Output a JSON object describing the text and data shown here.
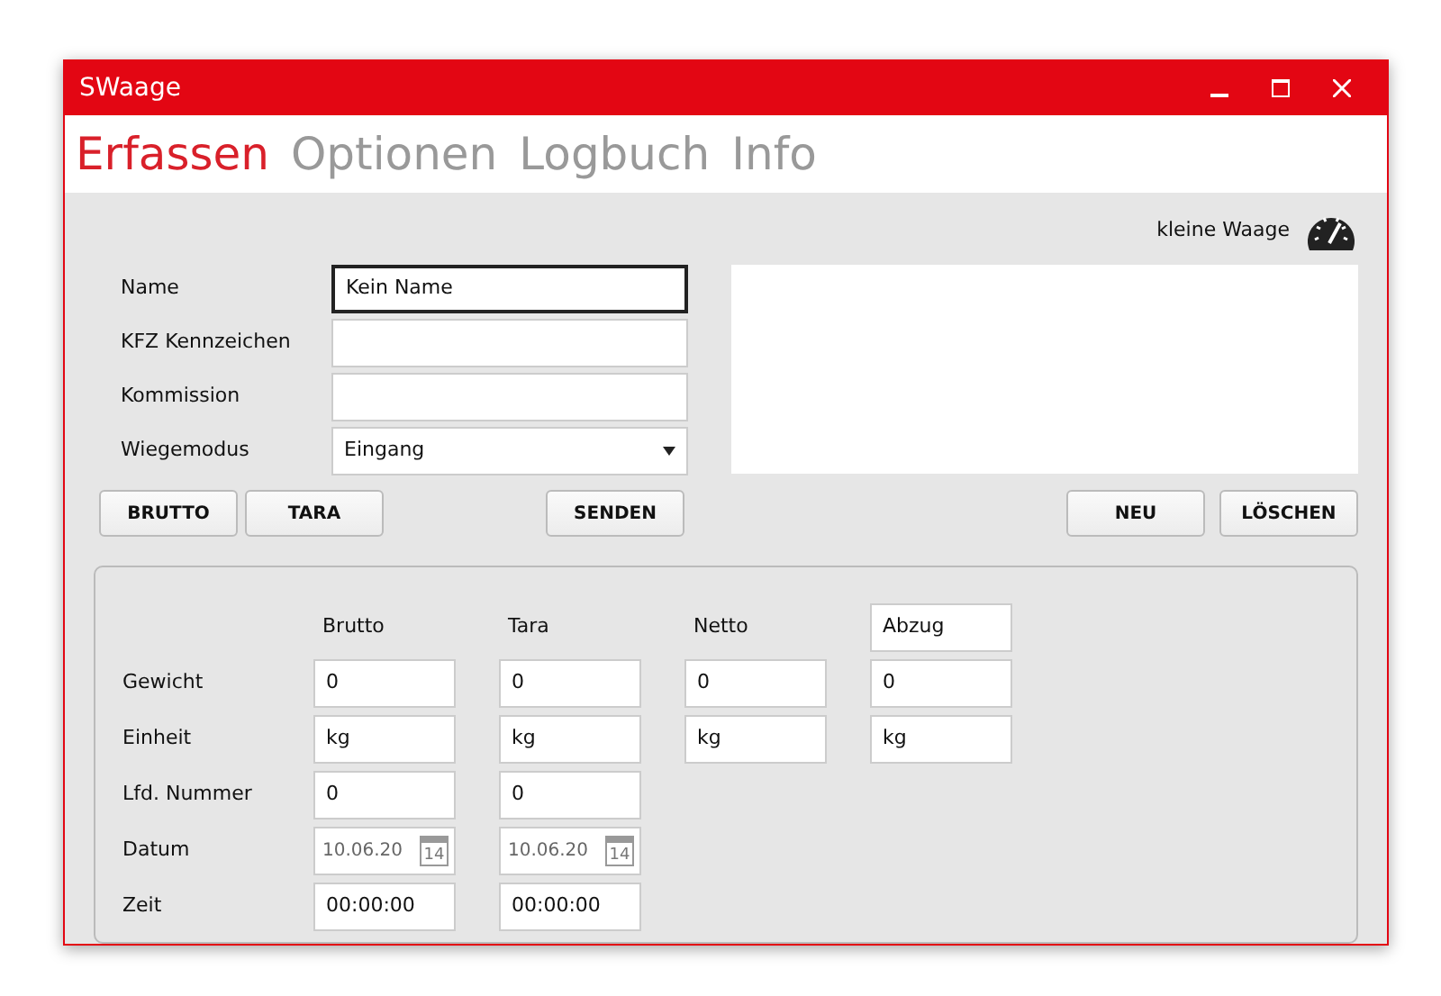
{
  "window": {
    "title": "SWaage"
  },
  "tabs": [
    {
      "label": "Erfassen",
      "selected": true
    },
    {
      "label": "Optionen",
      "selected": false
    },
    {
      "label": "Logbuch",
      "selected": false
    },
    {
      "label": "Info",
      "selected": false
    }
  ],
  "scale": {
    "label": "kleine Waage"
  },
  "form": [
    {
      "label": "Name",
      "kind": "text",
      "value": "Kein Name",
      "focused": true
    },
    {
      "label": "KFZ Kennzeichen",
      "kind": "text",
      "focused": false
    },
    {
      "label": "Kommission",
      "kind": "text",
      "focused": false
    },
    {
      "label": "Wiegemodus",
      "kind": "select",
      "value": "Eingang",
      "focused": false
    }
  ],
  "left_buttons": [
    "BRUTTO",
    "TARA",
    "SENDEN"
  ],
  "right_buttons": [
    "NEU",
    "LÖSCHEN"
  ],
  "weights": {
    "columns": [
      {
        "kind": "label",
        "text": "Brutto"
      },
      {
        "kind": "label",
        "text": "Tara"
      },
      {
        "kind": "label",
        "text": "Netto"
      },
      {
        "kind": "field",
        "text": "Abzug"
      }
    ],
    "rows": [
      {
        "label": "Gewicht",
        "cells": [
          {
            "kind": "text",
            "value": "0"
          },
          {
            "kind": "text",
            "value": "0"
          },
          {
            "kind": "text",
            "value": "0"
          },
          {
            "kind": "text",
            "value": "0"
          }
        ]
      },
      {
        "label": "Einheit",
        "cells": [
          {
            "kind": "text",
            "value": "kg"
          },
          {
            "kind": "text",
            "value": "kg"
          },
          {
            "kind": "text",
            "value": "kg"
          },
          {
            "kind": "text",
            "value": "kg"
          }
        ]
      },
      {
        "label": "Lfd. Nummer",
        "cells": [
          {
            "kind": "text",
            "value": "0"
          },
          {
            "kind": "text",
            "value": "0"
          }
        ]
      },
      {
        "label": "Datum",
        "cells": [
          {
            "kind": "date",
            "value": "10.06.20",
            "day": "14"
          },
          {
            "kind": "date",
            "value": "10.06.20",
            "day": "14"
          }
        ]
      },
      {
        "label": "Zeit",
        "cells": [
          {
            "kind": "text",
            "value": "00:00:00"
          },
          {
            "kind": "text",
            "value": "00:00:00"
          }
        ]
      }
    ]
  }
}
